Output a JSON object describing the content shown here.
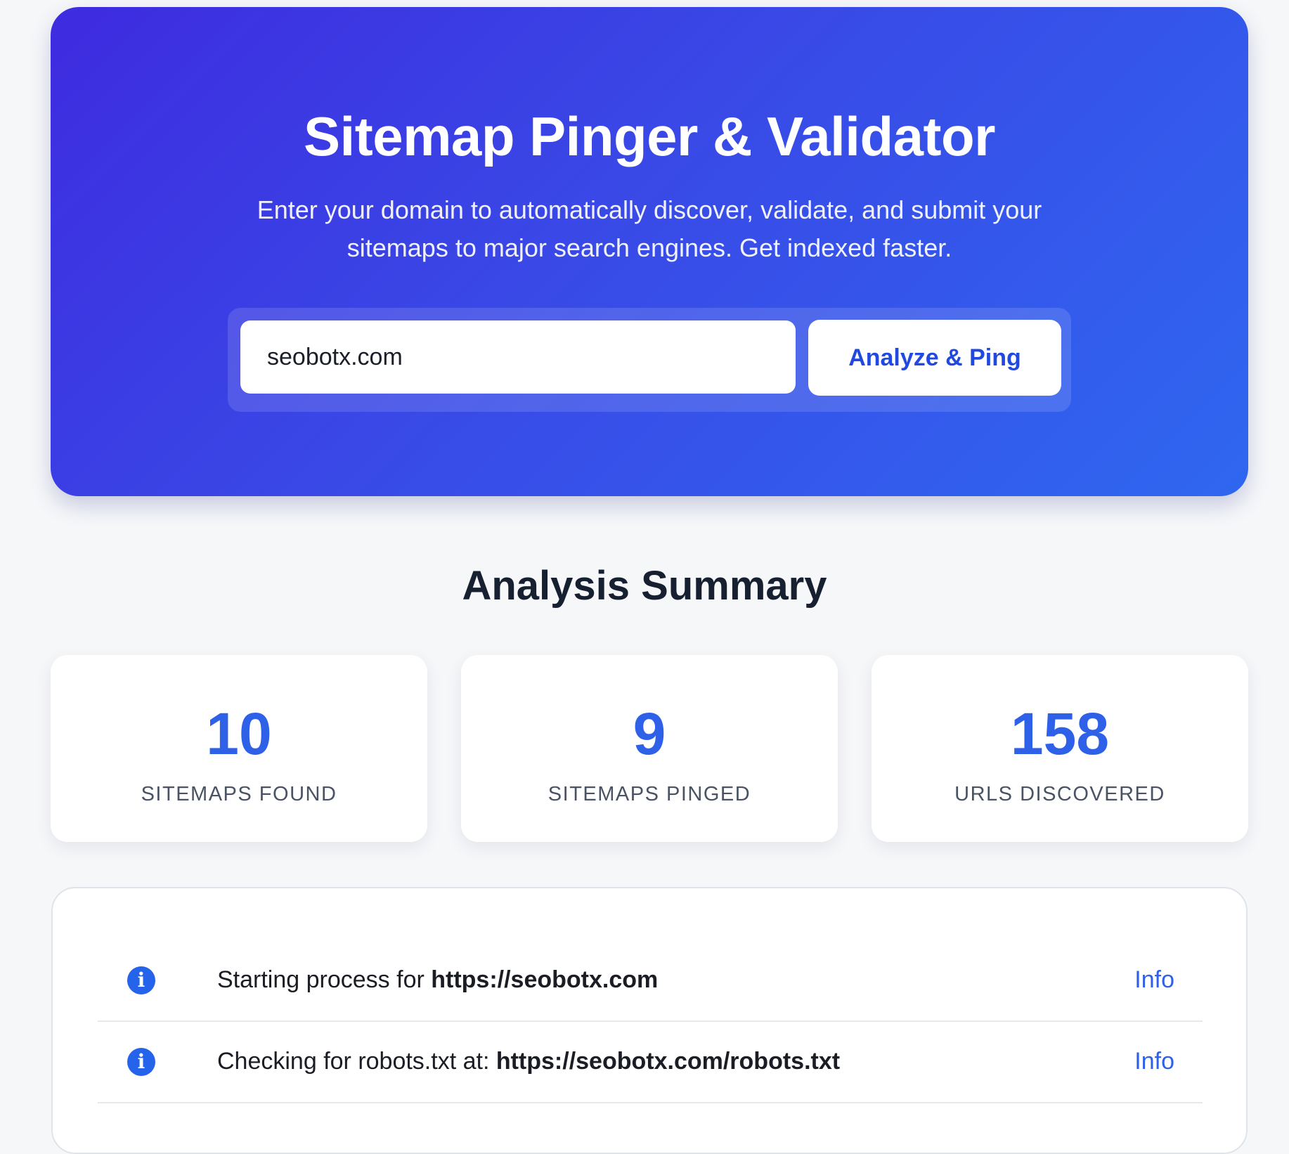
{
  "hero": {
    "title": "Sitemap Pinger & Validator",
    "description": "Enter your domain to automatically discover, validate, and submit your sitemaps to major search engines. Get indexed faster.",
    "domain_value": "seobotx.com",
    "button_label": "Analyze & Ping"
  },
  "summary": {
    "title": "Analysis Summary",
    "stats": [
      {
        "value": "10",
        "label": "Sitemaps Found"
      },
      {
        "value": "9",
        "label": "Sitemaps Pinged"
      },
      {
        "value": "158",
        "label": "URLs Discovered"
      }
    ]
  },
  "log": {
    "entries": [
      {
        "icon": "info-icon",
        "prefix": "Starting process for ",
        "url": "https://seobotx.com",
        "level": "Info"
      },
      {
        "icon": "info-icon",
        "prefix": "Checking for robots.txt at: ",
        "url": "https://seobotx.com/robots.txt",
        "level": "Info"
      }
    ]
  },
  "colors": {
    "hero_gradient_start": "#3e2be0",
    "hero_gradient_end": "#2f67f0",
    "accent_blue": "#2f61e8",
    "info_icon_blue": "#2563eb"
  }
}
